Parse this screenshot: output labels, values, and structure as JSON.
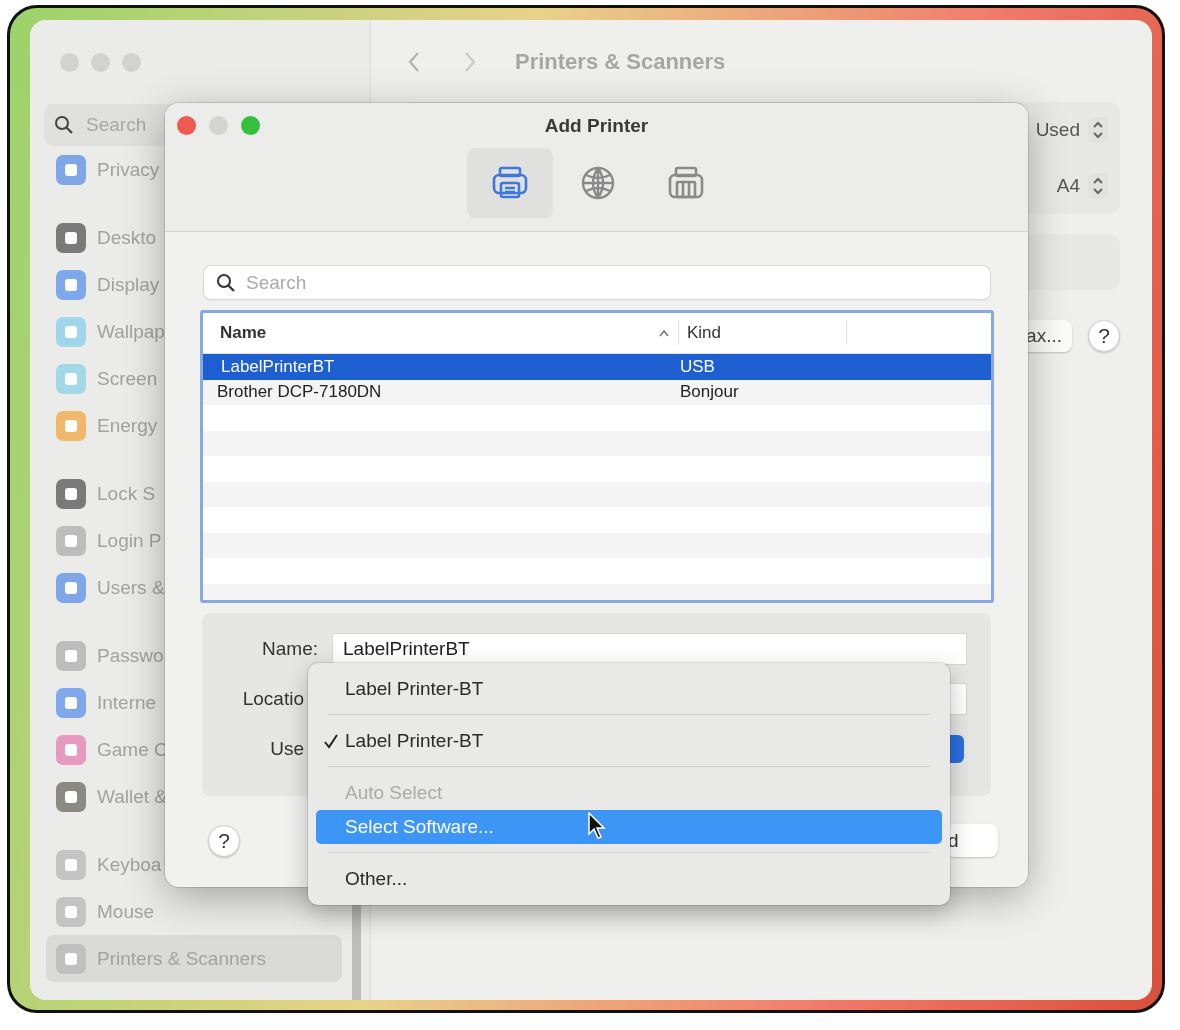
{
  "window": {
    "title": "Printers & Scanners"
  },
  "sidebar": {
    "search_placeholder": "Search",
    "groups": [
      [
        {
          "label": "Privacy",
          "color": "#7fa6e6",
          "selected": false
        }
      ],
      [
        {
          "label": "Deskto",
          "color": "#7a7a7a",
          "selected": false
        },
        {
          "label": "Display",
          "color": "#7fa8ec",
          "selected": false
        },
        {
          "label": "Wallpap",
          "color": "#9fd6ec",
          "selected": false
        },
        {
          "label": "Screen",
          "color": "#a3d8e8",
          "selected": false
        },
        {
          "label": "Energy",
          "color": "#f0b86a",
          "selected": false
        }
      ],
      [
        {
          "label": "Lock S",
          "color": "#7a7a7a",
          "selected": false
        },
        {
          "label": "Login P",
          "color": "#bdbdbd",
          "selected": false
        },
        {
          "label": "Users &",
          "color": "#7fa6e6",
          "selected": false
        }
      ],
      [
        {
          "label": "Passwo",
          "color": "#bdbdbd",
          "selected": false
        },
        {
          "label": "Interne",
          "color": "#7fa8ec",
          "selected": false
        },
        {
          "label": "Game C",
          "color": "#e69ac0",
          "selected": false
        },
        {
          "label": "Wallet &",
          "color": "#8a8a82",
          "selected": false
        }
      ],
      [
        {
          "label": "Keyboa",
          "color": "#c4c4c4",
          "selected": false
        },
        {
          "label": "Mouse",
          "color": "#c4c4c4",
          "selected": false
        },
        {
          "label": "Printers & Scanners",
          "color": "#c0c0c0",
          "selected": true
        }
      ]
    ]
  },
  "main": {
    "steppers": [
      {
        "value": "Used"
      },
      {
        "value": "A4"
      }
    ],
    "button": "ax...",
    "help": "?"
  },
  "dialog": {
    "title": "Add Printer",
    "toolbar": [
      {
        "kind": "local",
        "selected": true
      },
      {
        "kind": "network",
        "selected": false
      },
      {
        "kind": "shared",
        "selected": false
      }
    ],
    "search_placeholder": "Search",
    "columns": [
      {
        "label": "Name",
        "sorted": true
      },
      {
        "label": "Kind",
        "sorted": false
      }
    ],
    "rows": [
      {
        "name": "LabelPrinterBT",
        "kind": "USB",
        "selected": true
      },
      {
        "name": "Brother DCP-7180DN",
        "kind": "Bonjour",
        "selected": false
      }
    ],
    "form": {
      "name_label": "Name:",
      "name_value": "LabelPrinterBT",
      "location_label": "Locatio",
      "use_label": "Use"
    },
    "help": "?",
    "button": "d"
  },
  "menu": [
    {
      "kind": "item",
      "label": "Label Printer-BT",
      "checked": false,
      "disabled": false,
      "selected": false
    },
    {
      "kind": "separator"
    },
    {
      "kind": "item",
      "label": "Label Printer-BT",
      "checked": true,
      "disabled": false,
      "selected": false
    },
    {
      "kind": "separator"
    },
    {
      "kind": "item",
      "label": "Auto Select",
      "checked": false,
      "disabled": true,
      "selected": false
    },
    {
      "kind": "item",
      "label": "Select Software...",
      "checked": false,
      "disabled": false,
      "selected": true
    },
    {
      "kind": "separator"
    },
    {
      "kind": "item",
      "label": "Other...",
      "checked": false,
      "disabled": false,
      "selected": false
    }
  ]
}
